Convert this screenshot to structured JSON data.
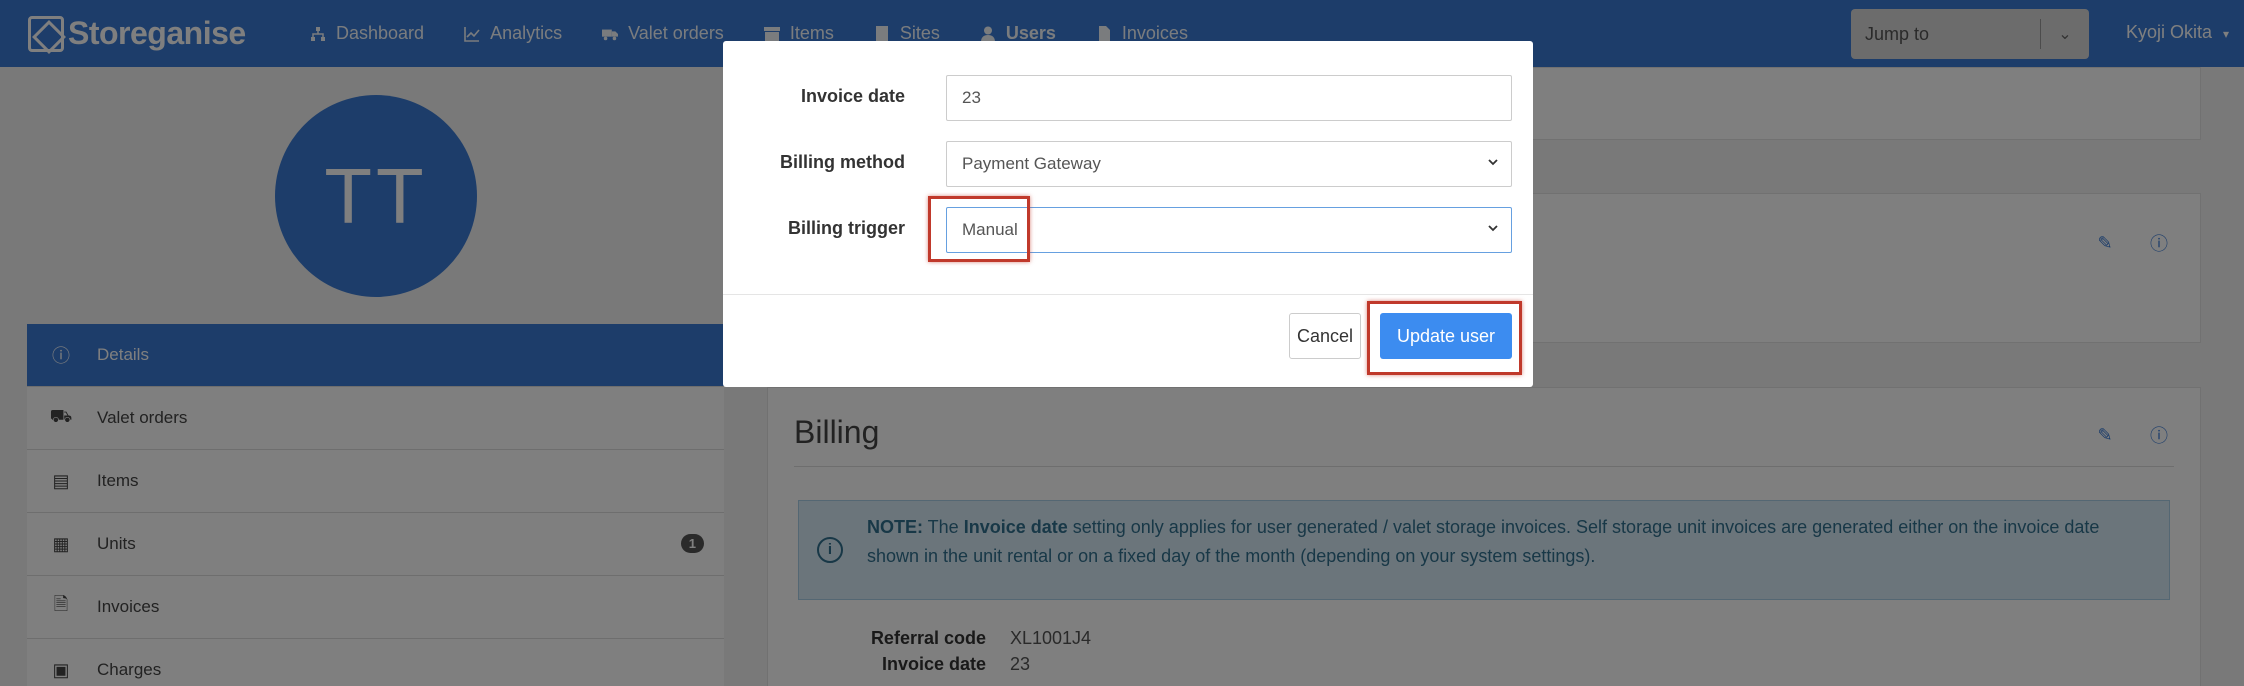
{
  "brand": {
    "name": "Storeganise"
  },
  "nav": {
    "items": [
      {
        "label": "Dashboard",
        "icon": "sitemap-icon"
      },
      {
        "label": "Analytics",
        "icon": "line-chart-icon"
      },
      {
        "label": "Valet orders",
        "icon": "truck-icon"
      },
      {
        "label": "Items",
        "icon": "archive-icon"
      },
      {
        "label": "Sites",
        "icon": "building-icon"
      },
      {
        "label": "Users",
        "icon": "user-icon"
      },
      {
        "label": "Invoices",
        "icon": "file-invoice-icon"
      }
    ],
    "jump_to": "Jump to",
    "user_name": "Kyoji Okita"
  },
  "profile": {
    "initials": "TT"
  },
  "sidebar": {
    "items": [
      {
        "label": "Details",
        "icon": "info-circle-icon"
      },
      {
        "label": "Valet orders",
        "icon": "truck-icon"
      },
      {
        "label": "Items",
        "icon": "archive-icon"
      },
      {
        "label": "Units",
        "icon": "building-icon",
        "badge": "1"
      },
      {
        "label": "Invoices",
        "icon": "file-invoice-icon"
      },
      {
        "label": "Charges",
        "icon": "money-icon"
      }
    ]
  },
  "billing": {
    "title": "Billing",
    "note_prefix": "NOTE:",
    "note_text_1": " The ",
    "note_bold": "Invoice date",
    "note_text_2": " setting only applies for user generated / valet storage invoices. Self storage unit invoices are generated either on the invoice date shown in the unit rental or on a fixed day of the month (depending on your system settings).",
    "fields": [
      {
        "label": "Referral code",
        "value": "XL1001J4"
      },
      {
        "label": "Invoice date",
        "value": "23"
      }
    ]
  },
  "modal": {
    "invoice_date": {
      "label": "Invoice date",
      "value": "23"
    },
    "billing_method": {
      "label": "Billing method",
      "value": "Payment Gateway"
    },
    "billing_trigger": {
      "label": "Billing trigger",
      "value": "Manual"
    },
    "cancel_label": "Cancel",
    "update_label": "Update user"
  },
  "colors": {
    "primary": "#3a7bd5",
    "button": "#3c8cf0",
    "highlight": "#c0392b"
  }
}
